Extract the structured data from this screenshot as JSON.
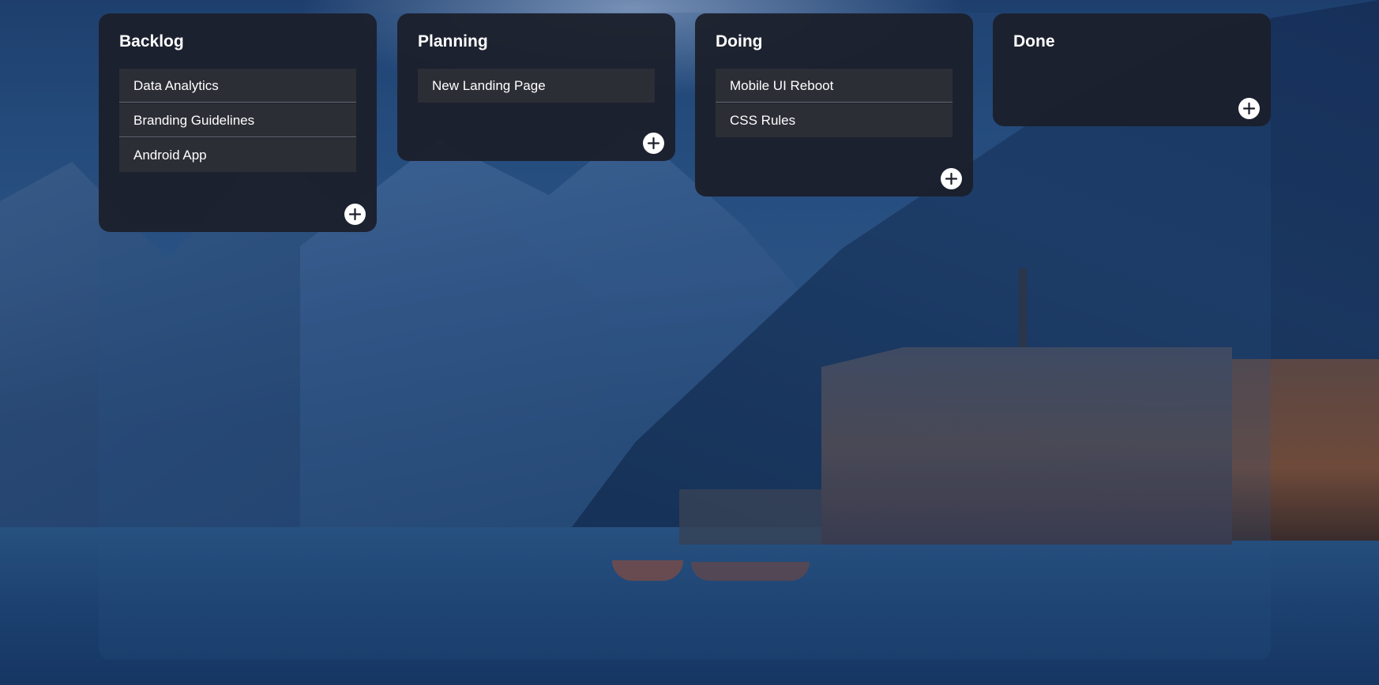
{
  "board": {
    "columns": [
      {
        "title": "Backlog",
        "cards": [
          "Data Analytics",
          "Branding Guidelines",
          "Android App"
        ],
        "add_icon": "plus-icon"
      },
      {
        "title": "Planning",
        "cards": [
          "New Landing Page"
        ],
        "add_icon": "plus-icon"
      },
      {
        "title": "Doing",
        "cards": [
          "Mobile UI Reboot",
          "CSS Rules"
        ],
        "add_icon": "plus-icon"
      },
      {
        "title": "Done",
        "cards": [],
        "add_icon": "plus-icon"
      }
    ]
  },
  "colors": {
    "column_bg": "#1c1f2b",
    "card_bg": "#2c2e36",
    "text": "#ffffff",
    "add_button_bg": "#ffffff",
    "add_button_icon": "#1c1f2b"
  }
}
